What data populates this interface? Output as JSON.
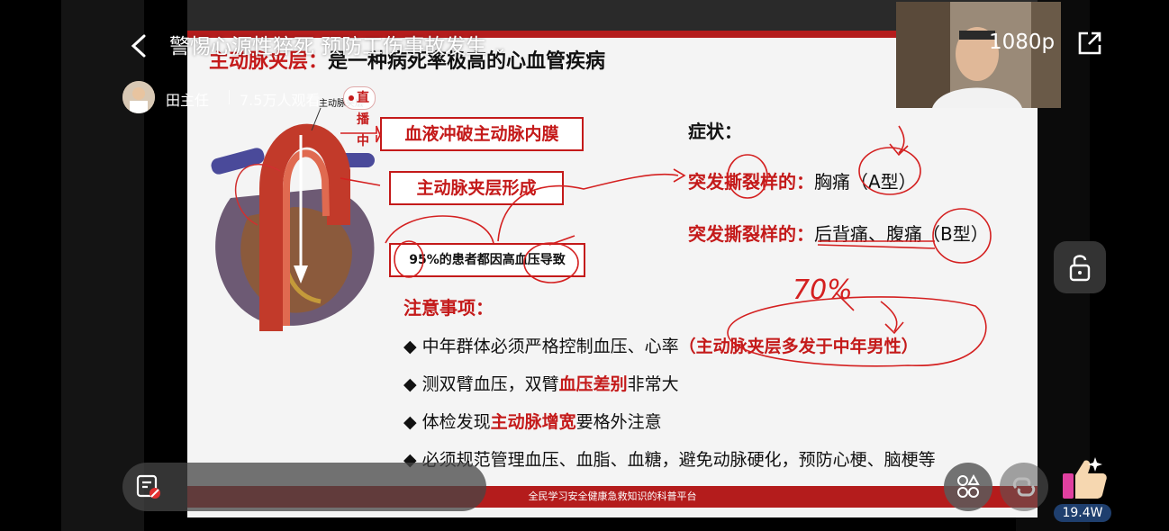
{
  "stream": {
    "title": "警惕心源性猝死 预防工伤事故发生",
    "title_caret": "⌄",
    "host_name": "田主任",
    "viewers": "7.5万人观看",
    "live_status": "直播中",
    "resolution": "1080p",
    "likes": "19.4W"
  },
  "slide": {
    "title_red": "主动脉夹层：",
    "title_black": "是一种病死率极高的心血管疾病",
    "heart_label": "主动脉夹层",
    "box1": "血液冲破主动脉内膜",
    "box2": "主动脉夹层形成",
    "box3": "95%的患者都因高血压导致",
    "symptoms_head": "症状：",
    "sym1_red": "突发撕裂样的：",
    "sym1_text": "胸痛（A型）",
    "sym2_red": "突发撕裂样的：",
    "sym2_text": "后背痛、腹痛（B型）",
    "notice_head": "注意事项：",
    "b1_pre": "◆ 中年群体必须严格控制血压、心率",
    "b1_red": "（主动脉夹层多发于中年男性）",
    "b2_pre": "◆ 测双臂血压，双臂",
    "b2_red": "血压差别",
    "b2_post": "非常大",
    "b3_pre": "◆ 体检发现",
    "b3_red": "主动脉增宽",
    "b3_post": "要格外注意",
    "b4": "◆ 必须规范管理血压、血脂、血糖，避免动脉硬化，预防心梗、脑梗等",
    "footer": "全民学习安全健康急救知识的科普平台",
    "handwriting_70": "70%"
  },
  "colors": {
    "accent_red": "#c41a1a",
    "slide_bg": "#f4f4f4",
    "likes_badge": "#1f3f6e"
  }
}
